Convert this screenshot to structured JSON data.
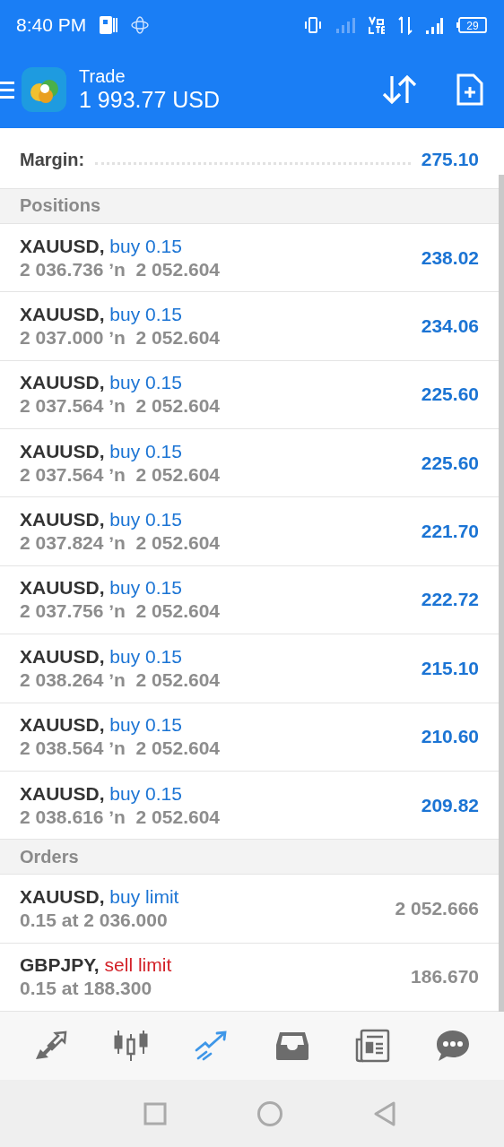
{
  "status_bar": {
    "time": "8:40 PM",
    "battery": "29"
  },
  "header": {
    "title": "Trade",
    "balance": "1 993.77 USD"
  },
  "summary": [
    {
      "label": "Margin:",
      "value": "275.10"
    }
  ],
  "positions": {
    "title": "Positions",
    "items": [
      {
        "symbol": "XAUUSD,",
        "side": "buy 0.15",
        "kind": "buy",
        "prices": "2 036.736 ʼn  2 052.604",
        "profit": "238.02"
      },
      {
        "symbol": "XAUUSD,",
        "side": "buy 0.15",
        "kind": "buy",
        "prices": "2 037.000 ʼn  2 052.604",
        "profit": "234.06"
      },
      {
        "symbol": "XAUUSD,",
        "side": "buy 0.15",
        "kind": "buy",
        "prices": "2 037.564 ʼn  2 052.604",
        "profit": "225.60"
      },
      {
        "symbol": "XAUUSD,",
        "side": "buy 0.15",
        "kind": "buy",
        "prices": "2 037.564 ʼn  2 052.604",
        "profit": "225.60"
      },
      {
        "symbol": "XAUUSD,",
        "side": "buy 0.15",
        "kind": "buy",
        "prices": "2 037.824 ʼn  2 052.604",
        "profit": "221.70"
      },
      {
        "symbol": "XAUUSD,",
        "side": "buy 0.15",
        "kind": "buy",
        "prices": "2 037.756 ʼn  2 052.604",
        "profit": "222.72"
      },
      {
        "symbol": "XAUUSD,",
        "side": "buy 0.15",
        "kind": "buy",
        "prices": "2 038.264 ʼn  2 052.604",
        "profit": "215.10"
      },
      {
        "symbol": "XAUUSD,",
        "side": "buy 0.15",
        "kind": "buy",
        "prices": "2 038.564 ʼn  2 052.604",
        "profit": "210.60"
      },
      {
        "symbol": "XAUUSD,",
        "side": "buy 0.15",
        "kind": "buy",
        "prices": "2 038.616 ʼn  2 052.604",
        "profit": "209.82"
      }
    ]
  },
  "orders": {
    "title": "Orders",
    "items": [
      {
        "symbol": "XAUUSD,",
        "side": "buy limit",
        "kind": "buy",
        "details": "0.15 at 2 036.000",
        "price": "2 052.666"
      },
      {
        "symbol": "GBPJPY,",
        "side": "sell limit",
        "kind": "sell",
        "details": "0.15 at 188.300",
        "price": "186.670"
      }
    ]
  },
  "bottom_nav": [
    {
      "kind": "quotes",
      "selected": false
    },
    {
      "kind": "chart",
      "selected": false
    },
    {
      "kind": "trade",
      "selected": true
    },
    {
      "kind": "history",
      "selected": false
    },
    {
      "kind": "news",
      "selected": false
    },
    {
      "kind": "chat",
      "selected": false
    }
  ]
}
